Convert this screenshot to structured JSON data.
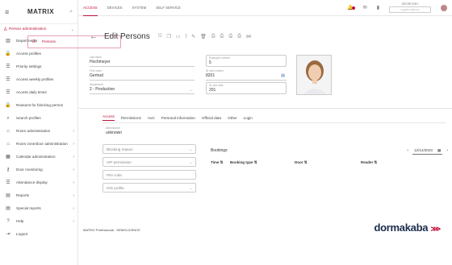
{
  "brand": "MATRIX",
  "sidebar": {
    "group": "Person administration",
    "items": [
      {
        "label": "Persons",
        "icon": "person-icon",
        "selected": true
      },
      {
        "label": "Departments",
        "icon": "building-icon"
      },
      {
        "label": "Access profiles",
        "icon": "lock-icon"
      },
      {
        "label": "Priority settings",
        "icon": "list-icon"
      },
      {
        "label": "Access weekly profiles",
        "icon": "list-icon"
      },
      {
        "label": "Access daily times",
        "icon": "list-icon"
      },
      {
        "label": "Reasons for blocking person",
        "icon": "lock-icon"
      },
      {
        "label": "Search profiles",
        "icon": "search-icon"
      },
      {
        "label": "Room administration",
        "icon": "door-icon",
        "chev": true
      },
      {
        "label": "Room zone/door administration",
        "icon": "door-icon",
        "chev": true
      },
      {
        "label": "Calendar administration",
        "icon": "calendar-icon",
        "chev": true
      },
      {
        "label": "Door monitoring",
        "icon": "key-icon",
        "chev": true
      },
      {
        "label": "Attendance display",
        "icon": "list-icon",
        "chev": true
      },
      {
        "label": "Reports",
        "icon": "report-icon",
        "chev": true
      },
      {
        "label": "Special reports",
        "icon": "report-icon",
        "chev": true
      },
      {
        "label": "Help",
        "icon": "help-icon",
        "chev": true
      },
      {
        "label": "Logout",
        "icon": "logout-icon"
      }
    ]
  },
  "topnav": [
    "ACCESS",
    "DEVICES",
    "SYSTEM",
    "SELF SERVICE"
  ],
  "user": {
    "name": "SECRETARY",
    "sub": "Logoff in 300 min"
  },
  "page": {
    "title": "Edit Persons"
  },
  "form": {
    "last_name": {
      "label": "Last name",
      "value": "Hochmeyer"
    },
    "first_name": {
      "label": "First name",
      "value": "Gertrud"
    },
    "department": {
      "label": "Department",
      "value": "2 - Production"
    },
    "employee_number": {
      "label": "Employee number",
      "value": "5"
    },
    "id_card": {
      "label": "ID card number",
      "value": "8201"
    },
    "id_card_data": {
      "label": "ID card data",
      "value": "201"
    }
  },
  "tabs": [
    "Access",
    "Permissions",
    "AoC",
    "Personal information",
    "Official data",
    "Other",
    "Login"
  ],
  "attendance": {
    "label": "Attendance",
    "value": "unknown"
  },
  "selects": [
    "Blocking reason",
    "VIP permission",
    "PIN code",
    "IOS profile"
  ],
  "bookings": {
    "title": "Bookings",
    "date": "12/14/2023",
    "cols": [
      "Time",
      "Booking type",
      "Door",
      "Reader"
    ]
  },
  "footer": {
    "text": "MATRIX Professional - DEMOLICENCE",
    "logo": "dormakaba"
  }
}
